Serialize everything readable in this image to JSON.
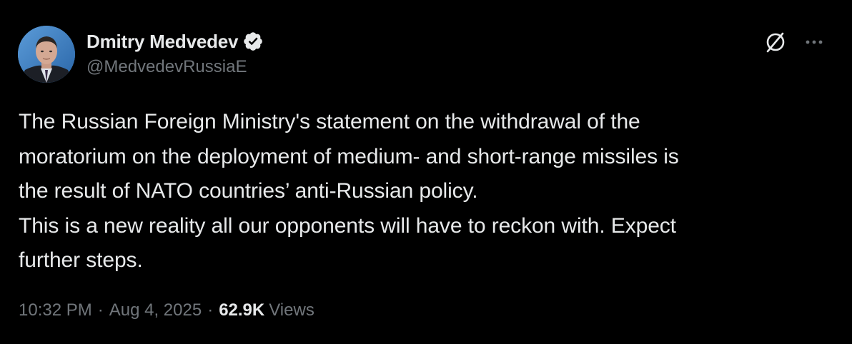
{
  "author": {
    "display_name": "Dmitry Medvedev",
    "handle": "@MedvedevRussiaE",
    "verified": true,
    "verified_color": "#e7e9ea"
  },
  "header_actions": {
    "grok_icon": "grok-slashed-circle-icon",
    "more_icon": "more-horizontal-icon"
  },
  "tweet": {
    "lines": [
      "The Russian Foreign Ministry's statement on the withdrawal of the",
      "moratorium on the deployment of medium- and short-range missiles is",
      "the result of NATO countries’ anti-Russian policy.",
      "This is a new reality all our opponents will have to reckon with. Expect",
      "further steps."
    ]
  },
  "meta": {
    "time": "10:32 PM",
    "separator": "·",
    "date": "Aug 4, 2025",
    "views_count": "62.9K",
    "views_label": "Views"
  },
  "colors": {
    "background": "#000000",
    "text_primary": "#e7e9ea",
    "text_secondary": "#71767b"
  }
}
